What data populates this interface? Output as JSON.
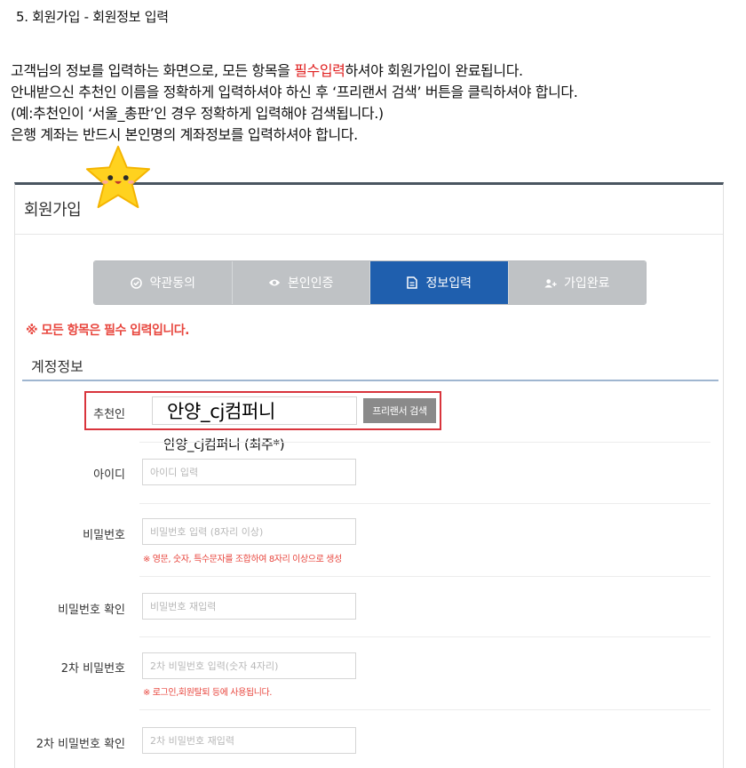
{
  "heading": "5. 회원가입 - 회원정보 입력",
  "intro": {
    "line1_a": "고객님의 정보를 입력하는 화면으로, 모든 항목을 ",
    "line1_req": "필수입력",
    "line1_b": "하셔야 회원가입이 완료됩니다.",
    "line2": "안내받으신 추천인 이름을 정확하게 입력하셔야 하신 후 ‘프리랜서 검색’ 버튼을 클릭하셔야 합니다.",
    "line3": "(예:추천인이 ‘서울_총판’인 경우 정확하게 입력해야 검색됩니다.)",
    "line4": "은행 계좌는 반드시 본인명의 계좌정보를 입력하셔야 합니다."
  },
  "panel": {
    "title": "회원가입",
    "steps": [
      {
        "label": "약관동의",
        "icon": "check-circle-icon",
        "active": false
      },
      {
        "label": "본인인증",
        "icon": "eye-icon",
        "active": false
      },
      {
        "label": "정보입력",
        "icon": "document-icon",
        "active": true
      },
      {
        "label": "가입완료",
        "icon": "user-add-icon",
        "active": false
      }
    ],
    "notice": "※ 모든 항목은 필수 입력입니다.",
    "section_title": "계정정보",
    "recommender": {
      "label": "추천인",
      "value": "안양_cj컴퍼니",
      "button": "프리랜서 검색",
      "suggestion": "안양_cj컴퍼니 (최주*)"
    },
    "fields": {
      "id": {
        "label": "아이디",
        "placeholder": "아이디 입력"
      },
      "password": {
        "label": "비밀번호",
        "placeholder": "비밀번호 입력 (8자리 이상)",
        "hint": "※ 영문, 숫자, 특수문자를 조합하여 8자리 이상으로 생성"
      },
      "password_confirm": {
        "label": "비밀번호 확인",
        "placeholder": "비밀번호 재입력"
      },
      "pin": {
        "label": "2차 비밀번호",
        "placeholder": "2차 비밀번호 입력(숫자 4자리)",
        "hint": "※ 로그인,회원탈퇴 등에 사용됩니다."
      },
      "pin_confirm": {
        "label": "2차 비밀번호 확인",
        "placeholder": "2차 비밀번호 재입력"
      }
    }
  },
  "colors": {
    "accent": "#1f5fae",
    "required": "#e02020",
    "highlight": "#d9343c",
    "step_inactive": "#bfc2c5"
  }
}
